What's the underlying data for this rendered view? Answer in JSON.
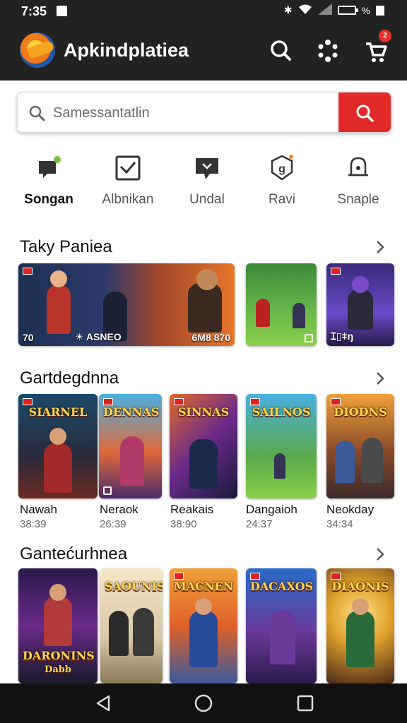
{
  "status": {
    "time": "7:35",
    "battery": "%"
  },
  "header": {
    "title": "Apkindplatiea",
    "cart_count": "2"
  },
  "search": {
    "placeholder": "Samessantatlin"
  },
  "categories": [
    {
      "label": "Songan"
    },
    {
      "label": "Albnikan"
    },
    {
      "label": "Undal"
    },
    {
      "label": "Ravi"
    },
    {
      "label": "Snaple"
    }
  ],
  "section1": {
    "title": "Taky Paniea",
    "tile1_left": "70",
    "tile1_mid": "☀ ASNEO",
    "tile1_right": "6M8 870"
  },
  "section2": {
    "title": "Gartdegdnna",
    "games": [
      {
        "banner": "SIARNEL",
        "name": "Nawah",
        "meta": "38:39"
      },
      {
        "banner": "DENNAS",
        "name": "Neraok",
        "meta": "26:39"
      },
      {
        "banner": "SINNAS",
        "name": "Reakais",
        "meta": "38:90"
      },
      {
        "banner": "SAILNOS",
        "name": "Dangaioh",
        "meta": "24:37"
      },
      {
        "banner": "DIODNS",
        "name": "Neokday",
        "meta": "34:34"
      }
    ]
  },
  "section3": {
    "title": "Gantećurhnea",
    "games": [
      {
        "banner": "DARONINS",
        "sub": "Dabb"
      },
      {
        "banner": "SAOUNIS"
      },
      {
        "banner": "MACNEN"
      },
      {
        "banner": "DACAXOS"
      },
      {
        "banner": "DIAONIS"
      }
    ]
  },
  "colors": {
    "header_bg": "#222222",
    "accent_red": "#e02a2a"
  }
}
